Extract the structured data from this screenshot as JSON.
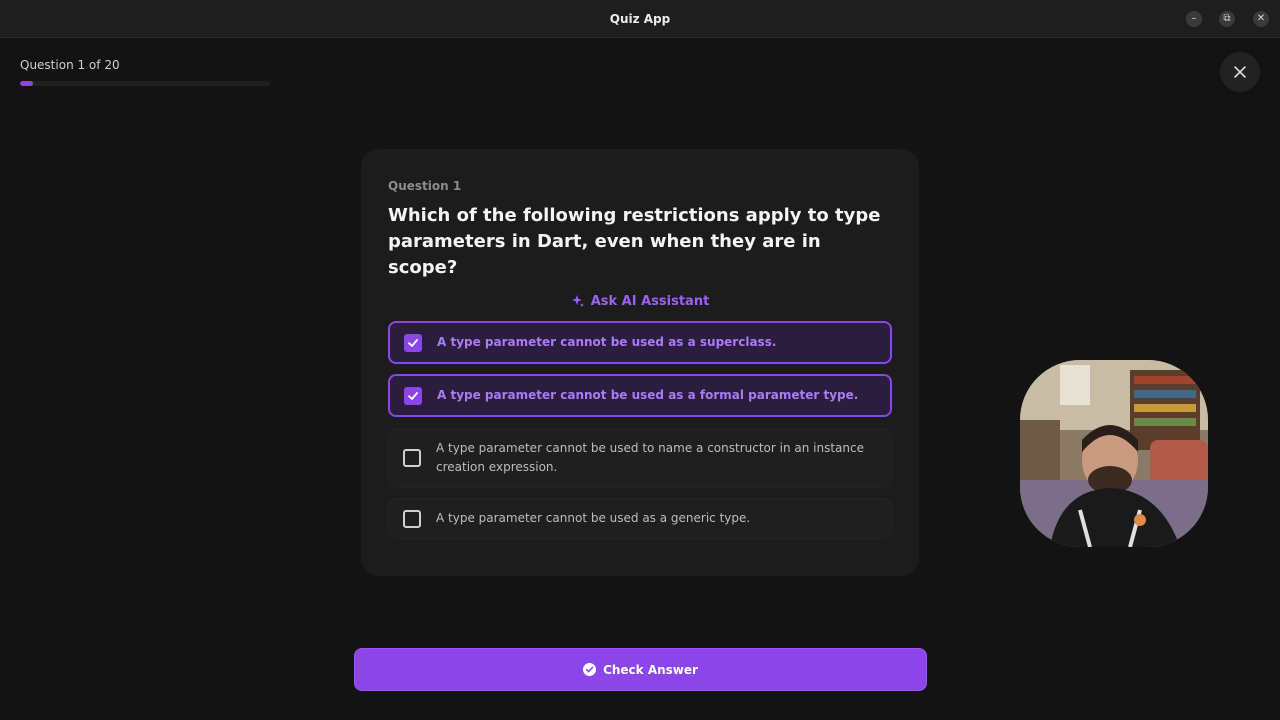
{
  "window": {
    "title": "Quiz App",
    "controls": {
      "minimize": "–",
      "restore": "⧉",
      "close": "✕"
    }
  },
  "progress": {
    "label": "Question 1 of 20",
    "current": 1,
    "total": 20,
    "fraction": 0.05
  },
  "question": {
    "number_label": "Question 1",
    "text": "Which of the following restrictions apply to type parameters in Dart, even when they are in scope?"
  },
  "ai_assistant": {
    "label": "Ask AI Assistant"
  },
  "options": [
    {
      "text": "A type parameter cannot be used as a superclass.",
      "checked": true
    },
    {
      "text": "A type parameter cannot be used as a formal parameter type.",
      "checked": true
    },
    {
      "text": "A type parameter cannot be used to name a constructor in an instance creation expression.",
      "checked": false
    },
    {
      "text": "A type parameter cannot be used as a generic type.",
      "checked": false
    }
  ],
  "actions": {
    "check_answer_label": "Check Answer"
  },
  "icons": {
    "close": "close-icon",
    "sparkle": "sparkle-icon",
    "check": "check-icon",
    "check_circle": "check-circle-icon"
  },
  "colors": {
    "accent": "#8b45e8",
    "accent_text": "#a97cf5",
    "background": "#131313",
    "card": "#1c1c1c"
  }
}
